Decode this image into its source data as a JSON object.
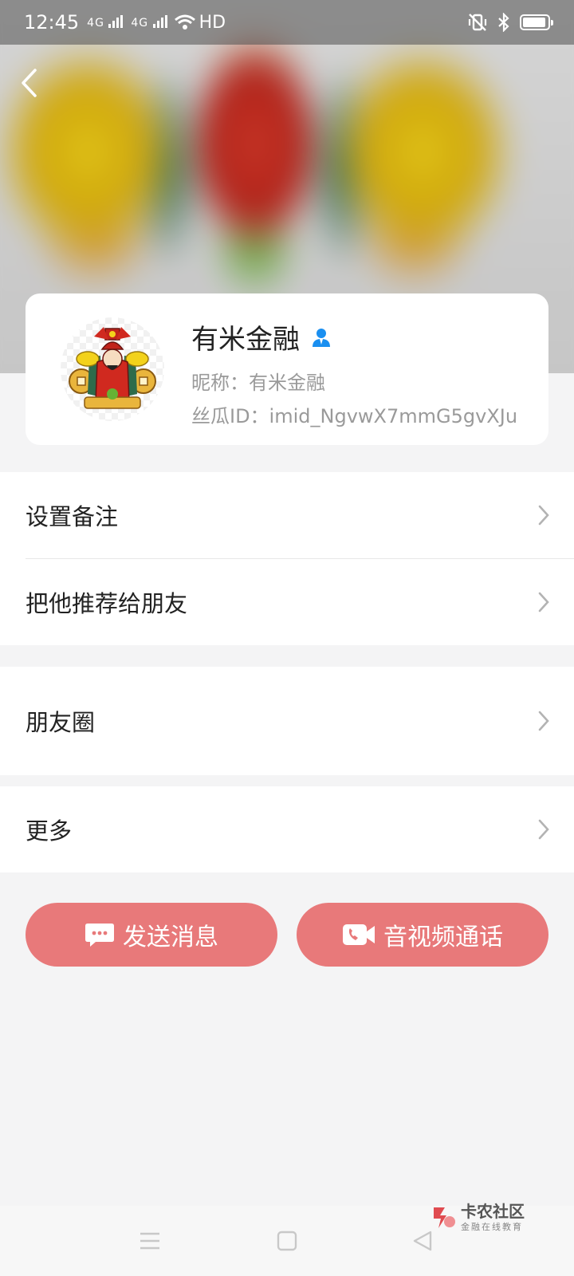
{
  "status_bar": {
    "time": "12:45",
    "network_1": "4G",
    "network_2": "4G",
    "hd_label": "HD"
  },
  "profile": {
    "display_name": "有米金融",
    "nickname_label": "昵称：有米金融",
    "id_label": "丝瓜ID：imid_NgvwX7mmG5gvXJu"
  },
  "menu": {
    "set_remark": "设置备注",
    "recommend": "把他推荐给朋友",
    "moments": "朋友圈",
    "more": "更多"
  },
  "actions": {
    "send_message": "发送消息",
    "av_call": "音视频通话"
  },
  "watermark": {
    "title": "卡农社区",
    "subtitle": "金融在线教育"
  },
  "colors": {
    "accent_button": "#e8797a",
    "verified_icon": "#1a8ff0"
  }
}
